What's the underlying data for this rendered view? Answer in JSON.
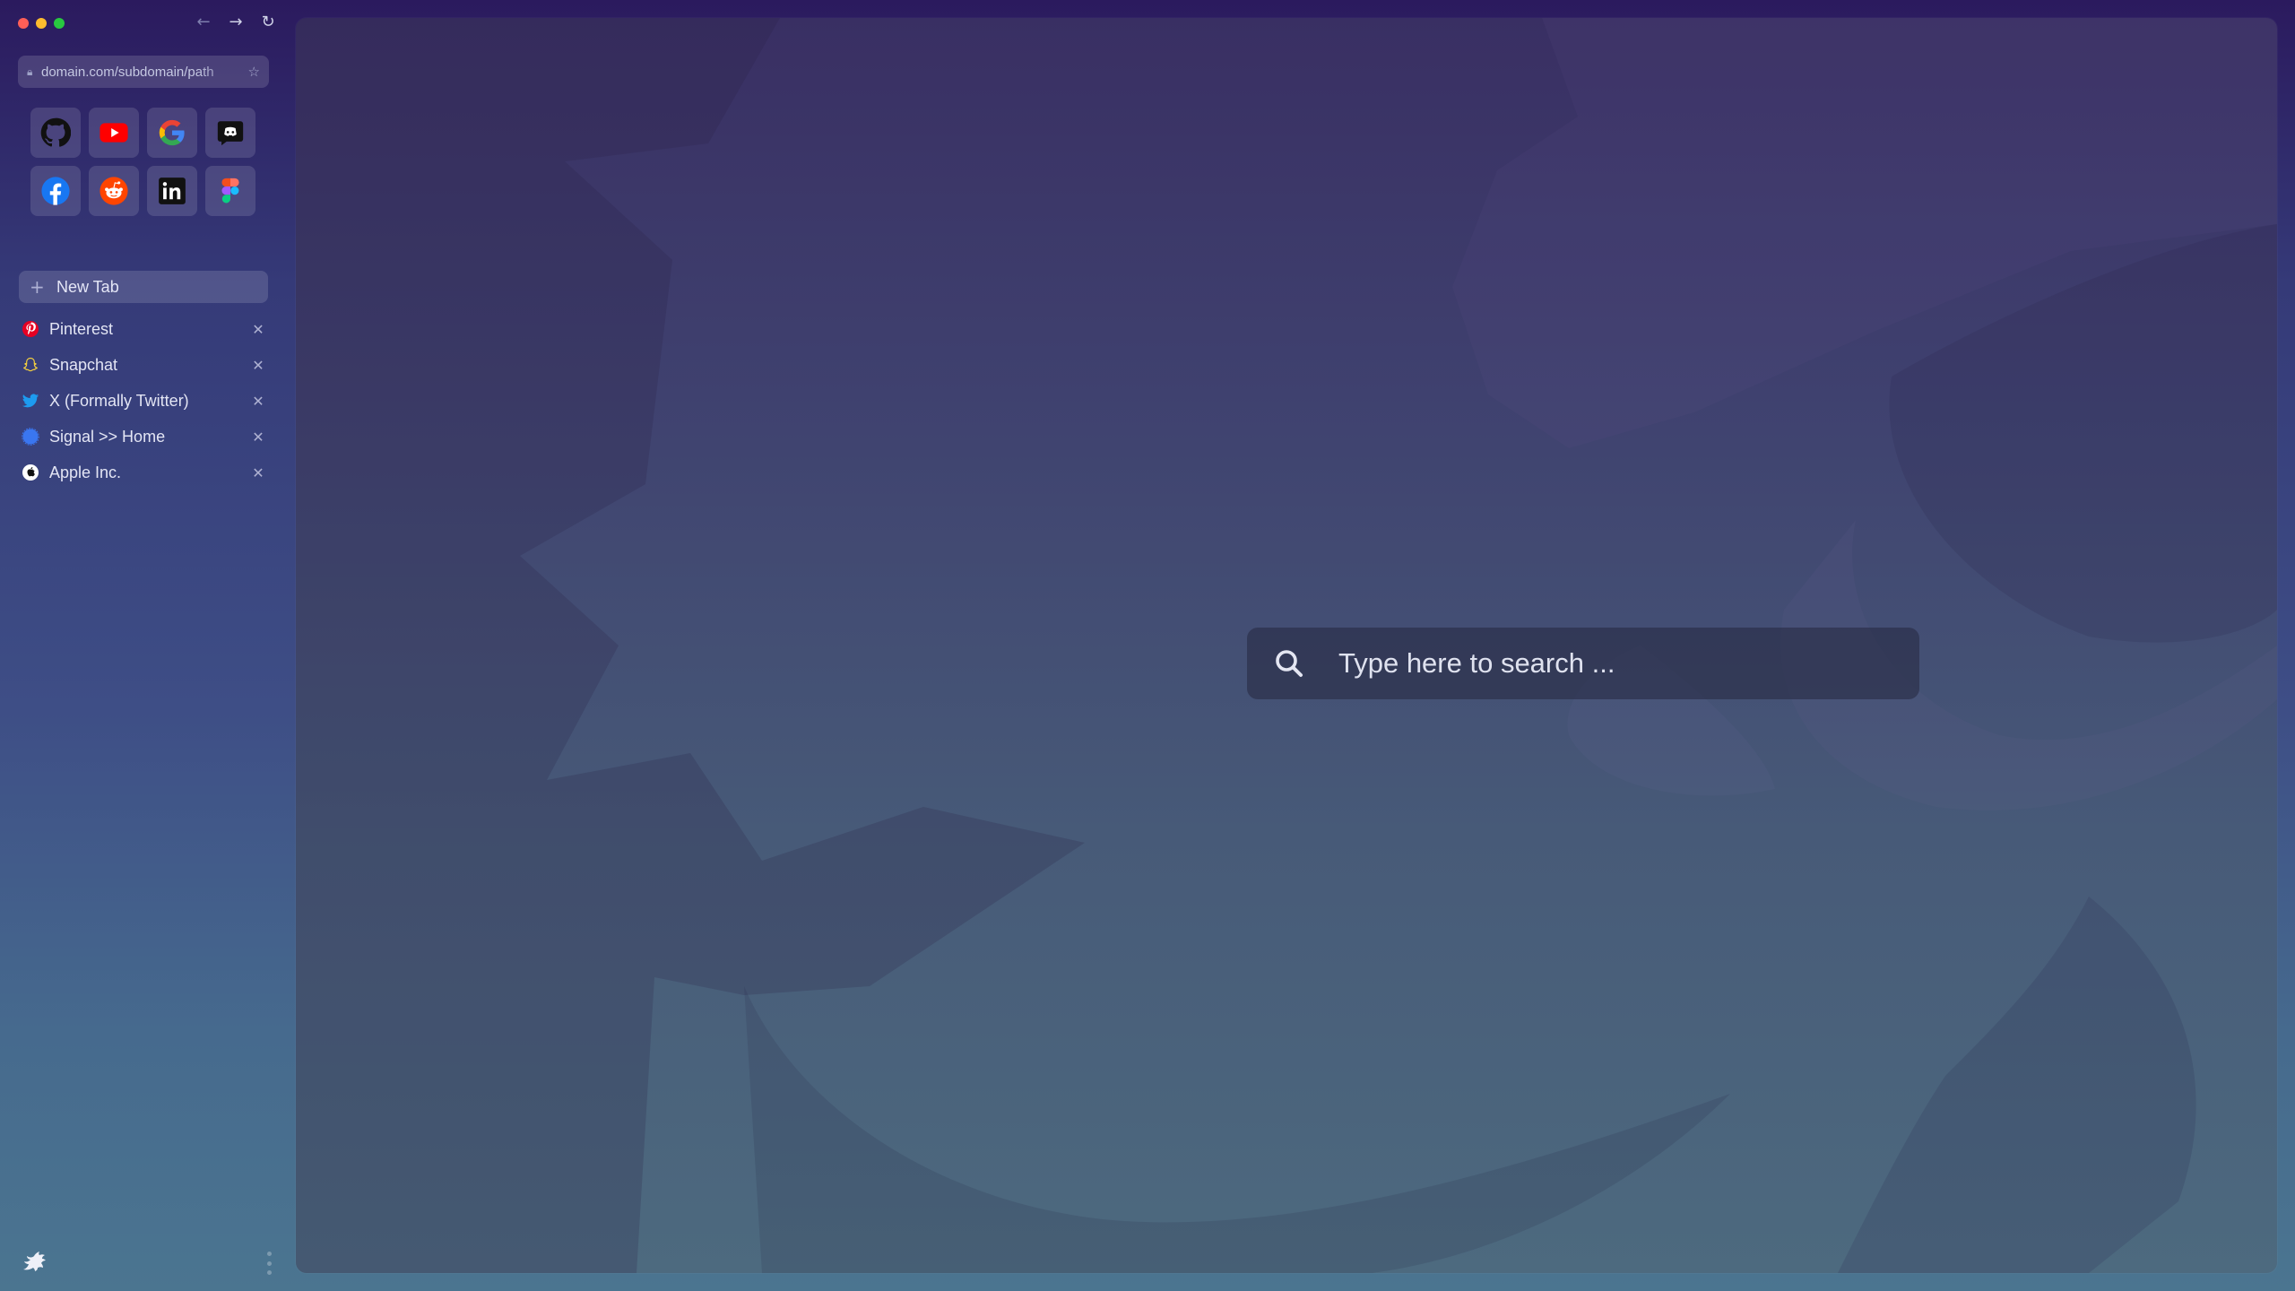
{
  "browser": {
    "url": "domain.com/subdomain/path",
    "nav": {
      "back_icon": "arrow-left-icon",
      "forward_icon": "arrow-right-icon",
      "reload_icon": "reload-icon"
    }
  },
  "favorites": [
    {
      "name": "GitHub",
      "icon": "github-icon"
    },
    {
      "name": "YouTube",
      "icon": "youtube-icon"
    },
    {
      "name": "Google",
      "icon": "google-icon"
    },
    {
      "name": "Discord",
      "icon": "discord-icon"
    },
    {
      "name": "Facebook",
      "icon": "facebook-icon"
    },
    {
      "name": "Reddit",
      "icon": "reddit-icon"
    },
    {
      "name": "LinkedIn",
      "icon": "linkedin-icon"
    },
    {
      "name": "Figma",
      "icon": "figma-icon"
    }
  ],
  "sidebar": {
    "new_tab_label": "New Tab",
    "tabs": [
      {
        "label": "Pinterest",
        "icon": "pinterest-icon"
      },
      {
        "label": "Snapchat",
        "icon": "snapchat-icon"
      },
      {
        "label": "X (Formally Twitter)",
        "icon": "twitter-icon"
      },
      {
        "label": "Signal >> Home",
        "icon": "signal-icon"
      },
      {
        "label": "Apple Inc.",
        "icon": "apple-icon"
      }
    ]
  },
  "search": {
    "placeholder": "Type here to search ..."
  },
  "colors": {
    "accent_gradient_top": "#2b1a5e",
    "accent_gradient_bottom": "#4b7590",
    "traffic_red": "#ff5f57",
    "traffic_yellow": "#febc2e",
    "traffic_green": "#28c840"
  }
}
